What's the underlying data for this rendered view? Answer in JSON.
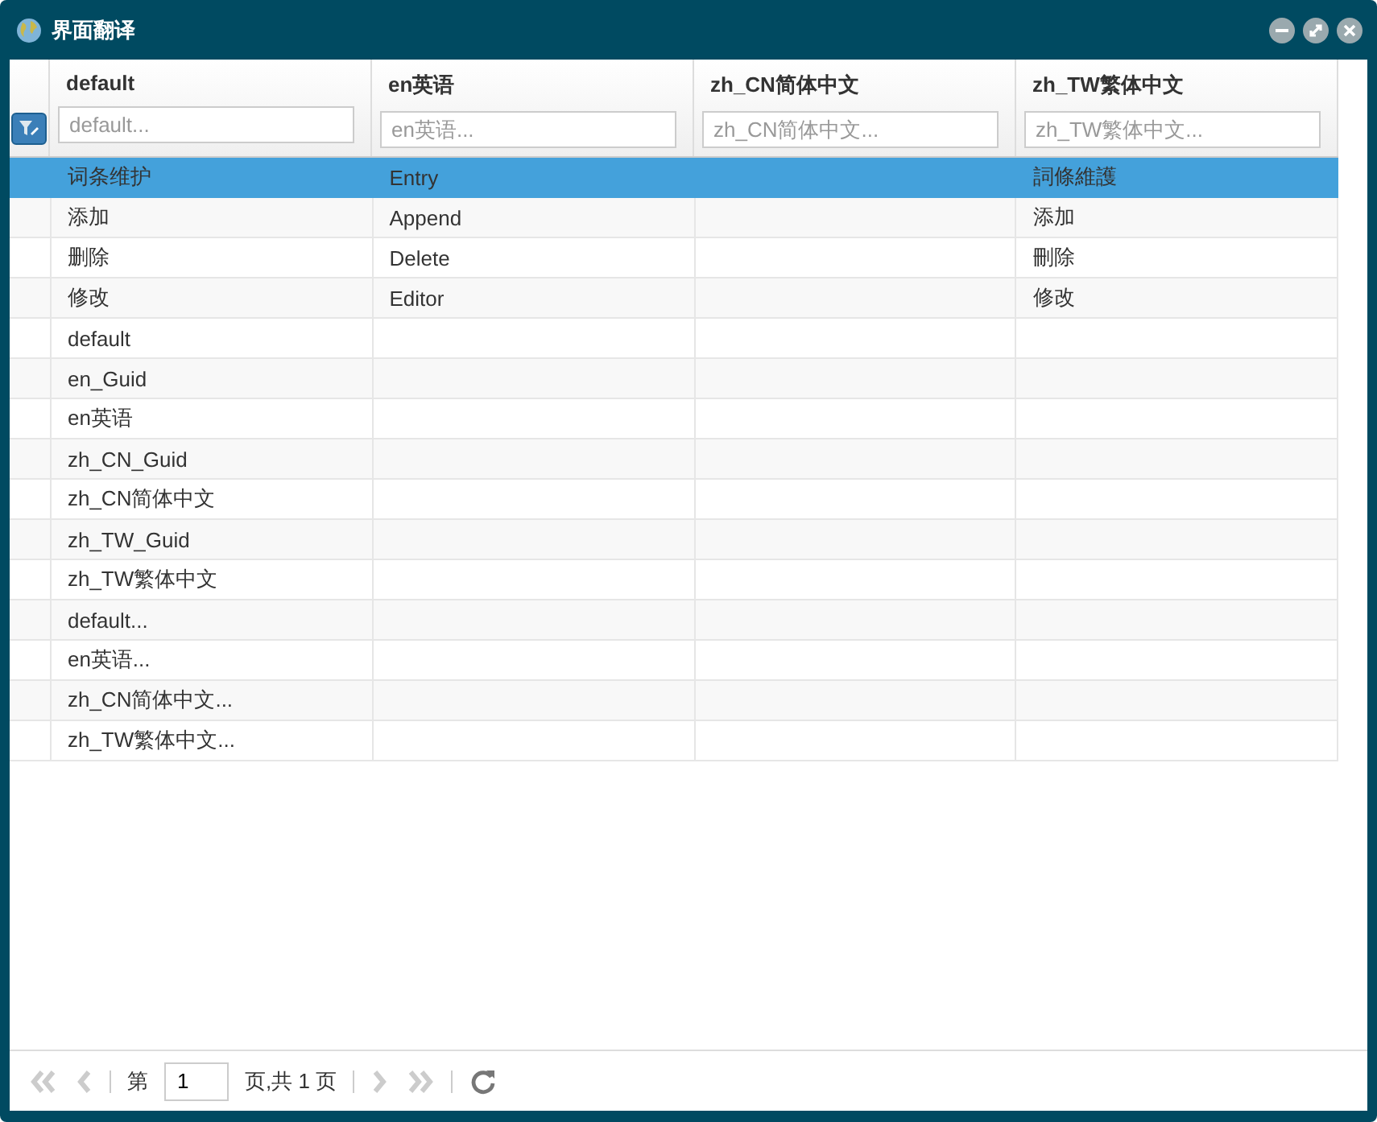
{
  "window": {
    "title": "界面翻译"
  },
  "columns": [
    {
      "title": "default",
      "placeholder": "default..."
    },
    {
      "title": "en英语",
      "placeholder": "en英语..."
    },
    {
      "title": "zh_CN简体中文",
      "placeholder": "zh_CN简体中文..."
    },
    {
      "title": "zh_TW繁体中文",
      "placeholder": "zh_TW繁体中文..."
    }
  ],
  "rows": [
    {
      "selected": true,
      "cells": [
        "词条维护",
        "Entry",
        null,
        "詞條維護"
      ]
    },
    {
      "selected": false,
      "cells": [
        "添加",
        "Append",
        null,
        "添加"
      ]
    },
    {
      "selected": false,
      "cells": [
        "删除",
        "Delete",
        null,
        "刪除"
      ]
    },
    {
      "selected": false,
      "cells": [
        "修改",
        "Editor",
        null,
        "修改"
      ]
    },
    {
      "selected": false,
      "cells": [
        "default",
        null,
        null,
        null
      ]
    },
    {
      "selected": false,
      "cells": [
        "en_Guid",
        null,
        null,
        null
      ]
    },
    {
      "selected": false,
      "cells": [
        "en英语",
        null,
        null,
        null
      ]
    },
    {
      "selected": false,
      "cells": [
        "zh_CN_Guid",
        null,
        null,
        null
      ]
    },
    {
      "selected": false,
      "cells": [
        "zh_CN简体中文",
        null,
        null,
        null
      ]
    },
    {
      "selected": false,
      "cells": [
        "zh_TW_Guid",
        null,
        null,
        null
      ]
    },
    {
      "selected": false,
      "cells": [
        "zh_TW繁体中文",
        null,
        null,
        null
      ]
    },
    {
      "selected": false,
      "cells": [
        "default...",
        null,
        null,
        null
      ]
    },
    {
      "selected": false,
      "cells": [
        "en英语...",
        null,
        null,
        null
      ]
    },
    {
      "selected": false,
      "cells": [
        "zh_CN简体中文...",
        null,
        null,
        null
      ]
    },
    {
      "selected": false,
      "cells": [
        "zh_TW繁体中文...",
        null,
        null,
        null
      ]
    }
  ],
  "pager": {
    "first_disabled": true,
    "prev_disabled": true,
    "page_label": "第",
    "page_value": "1",
    "total_label": "页,共 1 页",
    "next_disabled": true,
    "last_disabled": true
  }
}
